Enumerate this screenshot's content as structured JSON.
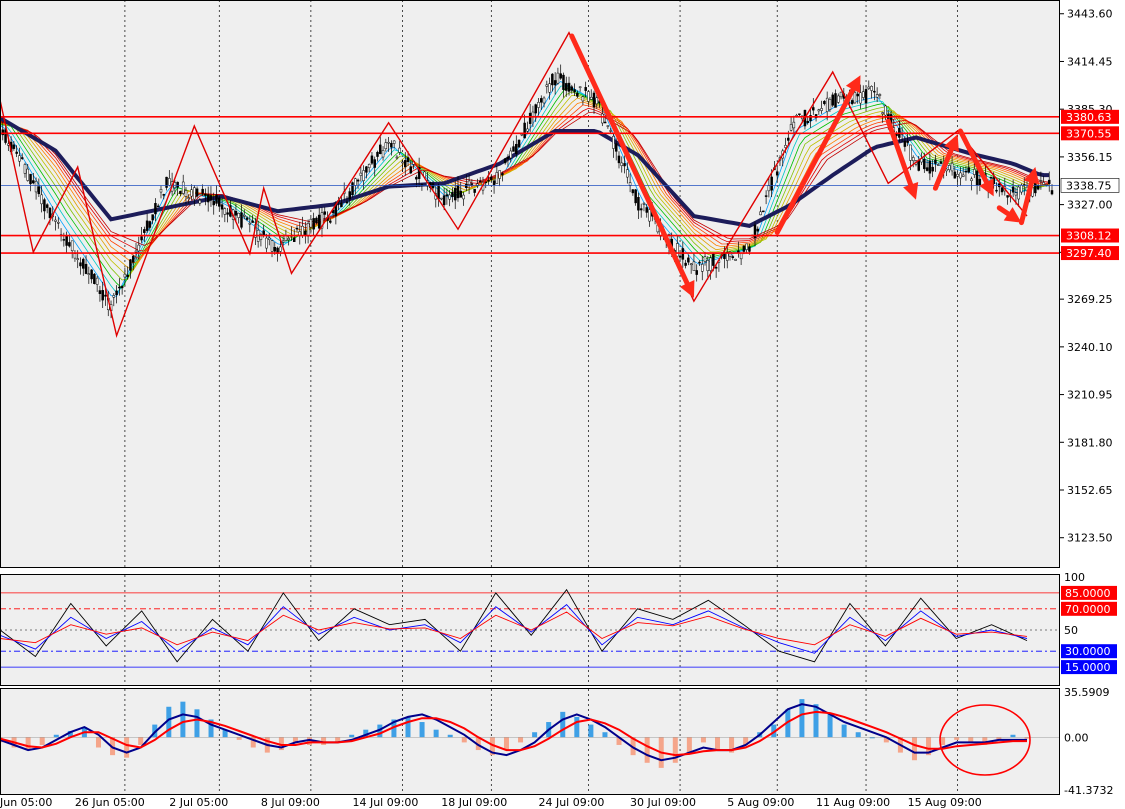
{
  "chart_data": [
    {
      "type": "candlestick",
      "panel": "price",
      "y_ticks": [
        "3443.60",
        "3414.45",
        "3385.30",
        "3356.15",
        "3327.00",
        "3297.85",
        "3269.25",
        "3240.10",
        "3210.95",
        "3181.80",
        "3152.65",
        "3123.50"
      ],
      "ylim": [
        3105.0,
        3452.0
      ],
      "x_labels": [
        "Jun 05:00",
        "26 Jun 05:00",
        "2 Jul 05:00",
        "8 Jul 09:00",
        "14 Jul 09:00",
        "18 Jul 09:00",
        "24 Jul 09:00",
        "30 Jul 09:00",
        "5 Aug 09:00",
        "11 Aug 09:00",
        "15 Aug 09:00"
      ],
      "price_tags": [
        {
          "label": "3380.63",
          "value": 3380.63,
          "style": "red-line"
        },
        {
          "label": "3370.55",
          "value": 3370.55,
          "style": "red-line"
        },
        {
          "label": "3338.75",
          "value": 3338.75,
          "style": "current"
        },
        {
          "label": "3308.12",
          "value": 3308.12,
          "style": "red-line"
        },
        {
          "label": "3297.40",
          "value": 3297.4,
          "style": "red-line"
        }
      ],
      "zigzag": [
        [
          0,
          3391
        ],
        [
          12,
          3298
        ],
        [
          28,
          3350
        ],
        [
          42,
          3247
        ],
        [
          70,
          3375
        ],
        [
          90,
          3297
        ],
        [
          95,
          3337
        ],
        [
          105,
          3285
        ],
        [
          140,
          3377
        ],
        [
          165,
          3312
        ],
        [
          205,
          3432
        ],
        [
          250,
          3268
        ],
        [
          300,
          3408
        ],
        [
          320,
          3340
        ],
        [
          345,
          3372
        ],
        [
          370,
          3320
        ]
      ],
      "arrows": [
        {
          "from": [
            206,
            3430
          ],
          "to": [
            250,
            3270
          ]
        },
        {
          "from": [
            280,
            3310
          ],
          "to": [
            310,
            3406
          ]
        },
        {
          "from": [
            320,
            3378
          ],
          "to": [
            330,
            3330
          ]
        },
        {
          "from": [
            337,
            3337
          ],
          "to": [
            345,
            3370
          ]
        },
        {
          "from": [
            346,
            3372
          ],
          "to": [
            358,
            3332
          ]
        },
        {
          "from": [
            360,
            3325
          ],
          "to": [
            368,
            3316
          ]
        },
        {
          "from": [
            368,
            3316
          ],
          "to": [
            373,
            3350
          ]
        }
      ],
      "series": [
        {
          "name": "close",
          "type": "line",
          "points": [
            [
              0,
              3375
            ],
            [
              20,
              3316
            ],
            [
              40,
              3265
            ],
            [
              60,
              3340
            ],
            [
              80,
              3327
            ],
            [
              100,
              3300
            ],
            [
              120,
              3322
            ],
            [
              140,
              3365
            ],
            [
              160,
              3330
            ],
            [
              180,
              3345
            ],
            [
              200,
              3405
            ],
            [
              215,
              3390
            ],
            [
              230,
              3328
            ],
            [
              250,
              3288
            ],
            [
              270,
              3300
            ],
            [
              285,
              3375
            ],
            [
              300,
              3390
            ],
            [
              315,
              3395
            ],
            [
              330,
              3353
            ],
            [
              350,
              3345
            ],
            [
              365,
              3333
            ],
            [
              375,
              3338
            ]
          ]
        },
        {
          "name": "slow MA",
          "type": "line",
          "points": [
            [
              0,
              3380
            ],
            [
              20,
              3360
            ],
            [
              40,
              3318
            ],
            [
              60,
              3325
            ],
            [
              80,
              3332
            ],
            [
              100,
              3323
            ],
            [
              120,
              3327
            ],
            [
              140,
              3338
            ],
            [
              160,
              3340
            ],
            [
              180,
              3352
            ],
            [
              200,
              3372
            ],
            [
              215,
              3372
            ],
            [
              230,
              3357
            ],
            [
              250,
              3320
            ],
            [
              270,
              3314
            ],
            [
              285,
              3327
            ],
            [
              300,
              3345
            ],
            [
              315,
              3362
            ],
            [
              330,
              3368
            ],
            [
              350,
              3358
            ],
            [
              365,
              3352
            ],
            [
              375,
              3345
            ]
          ]
        }
      ]
    },
    {
      "type": "line",
      "panel": "stochastic",
      "y_ticks": [
        "100",
        "50"
      ],
      "ylim": [
        0,
        100
      ],
      "levels": [
        {
          "label": "85.0000",
          "value": 85,
          "color": "#ff0000"
        },
        {
          "label": "70.0000",
          "value": 70,
          "color": "#ff0000"
        },
        {
          "label": "30.0000",
          "value": 30,
          "color": "#0000ff"
        },
        {
          "label": "15.0000",
          "value": 15,
          "color": "#0000ff"
        }
      ],
      "series": [
        {
          "name": "%K",
          "color": "#000000",
          "values": [
            50,
            25,
            75,
            35,
            68,
            20,
            60,
            30,
            85,
            40,
            70,
            55,
            60,
            30,
            85,
            45,
            88,
            30,
            70,
            60,
            78,
            55,
            30,
            20,
            75,
            35,
            80,
            42,
            55,
            40
          ]
        },
        {
          "name": "%D",
          "color": "#0000ff",
          "values": [
            45,
            32,
            62,
            42,
            58,
            30,
            52,
            36,
            72,
            46,
            62,
            50,
            55,
            38,
            72,
            48,
            74,
            36,
            62,
            55,
            68,
            52,
            38,
            28,
            62,
            40,
            68,
            44,
            50,
            42
          ]
        },
        {
          "name": "signal",
          "color": "#ff0000",
          "values": [
            42,
            38,
            55,
            46,
            52,
            36,
            48,
            40,
            64,
            50,
            57,
            51,
            52,
            42,
            64,
            50,
            67,
            42,
            57,
            54,
            63,
            51,
            42,
            36,
            55,
            44,
            61,
            46,
            48,
            44
          ]
        }
      ]
    },
    {
      "type": "bar",
      "panel": "macd",
      "y_ticks": [
        "35.5909",
        "0.00",
        "-41.3732"
      ],
      "ylim": [
        -41.3732,
        35.5909
      ],
      "histogram": [
        -4,
        -8,
        -10,
        -6,
        2,
        5,
        8,
        -8,
        -14,
        -16,
        -6,
        10,
        24,
        28,
        22,
        14,
        6,
        -2,
        -8,
        -12,
        -10,
        -4,
        -6,
        -6,
        -4,
        2,
        6,
        10,
        14,
        16,
        12,
        6,
        2,
        -4,
        -10,
        -14,
        -10,
        -4,
        4,
        12,
        20,
        16,
        10,
        4,
        -6,
        -14,
        -20,
        -24,
        -20,
        -12,
        -4,
        -10,
        -12,
        -6,
        4,
        10,
        22,
        30,
        26,
        18,
        10,
        4,
        0,
        -4,
        -12,
        -18,
        -14,
        -6,
        -2,
        -4,
        -6,
        -2,
        2,
        -1
      ],
      "series": [
        {
          "name": "MACD",
          "color": "#00008b",
          "values": [
            -2,
            -6,
            -10,
            -8,
            -2,
            4,
            8,
            2,
            -8,
            -12,
            -8,
            4,
            14,
            18,
            16,
            10,
            6,
            2,
            -2,
            -6,
            -8,
            -4,
            -2,
            -4,
            -4,
            -2,
            2,
            6,
            12,
            16,
            18,
            14,
            8,
            2,
            -6,
            -12,
            -14,
            -10,
            -4,
            6,
            14,
            18,
            14,
            8,
            0,
            -8,
            -14,
            -18,
            -16,
            -12,
            -8,
            -10,
            -10,
            -6,
            2,
            12,
            22,
            26,
            24,
            18,
            12,
            8,
            4,
            0,
            -6,
            -12,
            -12,
            -8,
            -4,
            -4,
            -4,
            -2,
            -2,
            -2
          ]
        },
        {
          "name": "Signal",
          "color": "#ff0000",
          "values": [
            -1,
            -4,
            -7,
            -8,
            -5,
            0,
            4,
            4,
            -1,
            -6,
            -8,
            -2,
            6,
            12,
            14,
            12,
            9,
            5,
            1,
            -3,
            -6,
            -6,
            -4,
            -4,
            -4,
            -3,
            0,
            3,
            8,
            12,
            15,
            15,
            12,
            7,
            0,
            -6,
            -10,
            -10,
            -7,
            -1,
            6,
            12,
            14,
            11,
            6,
            -1,
            -7,
            -12,
            -14,
            -13,
            -11,
            -10,
            -10,
            -8,
            -3,
            4,
            12,
            18,
            20,
            19,
            16,
            12,
            8,
            4,
            -1,
            -6,
            -9,
            -9,
            -7,
            -6,
            -5,
            -4,
            -3,
            -3
          ]
        }
      ]
    }
  ]
}
